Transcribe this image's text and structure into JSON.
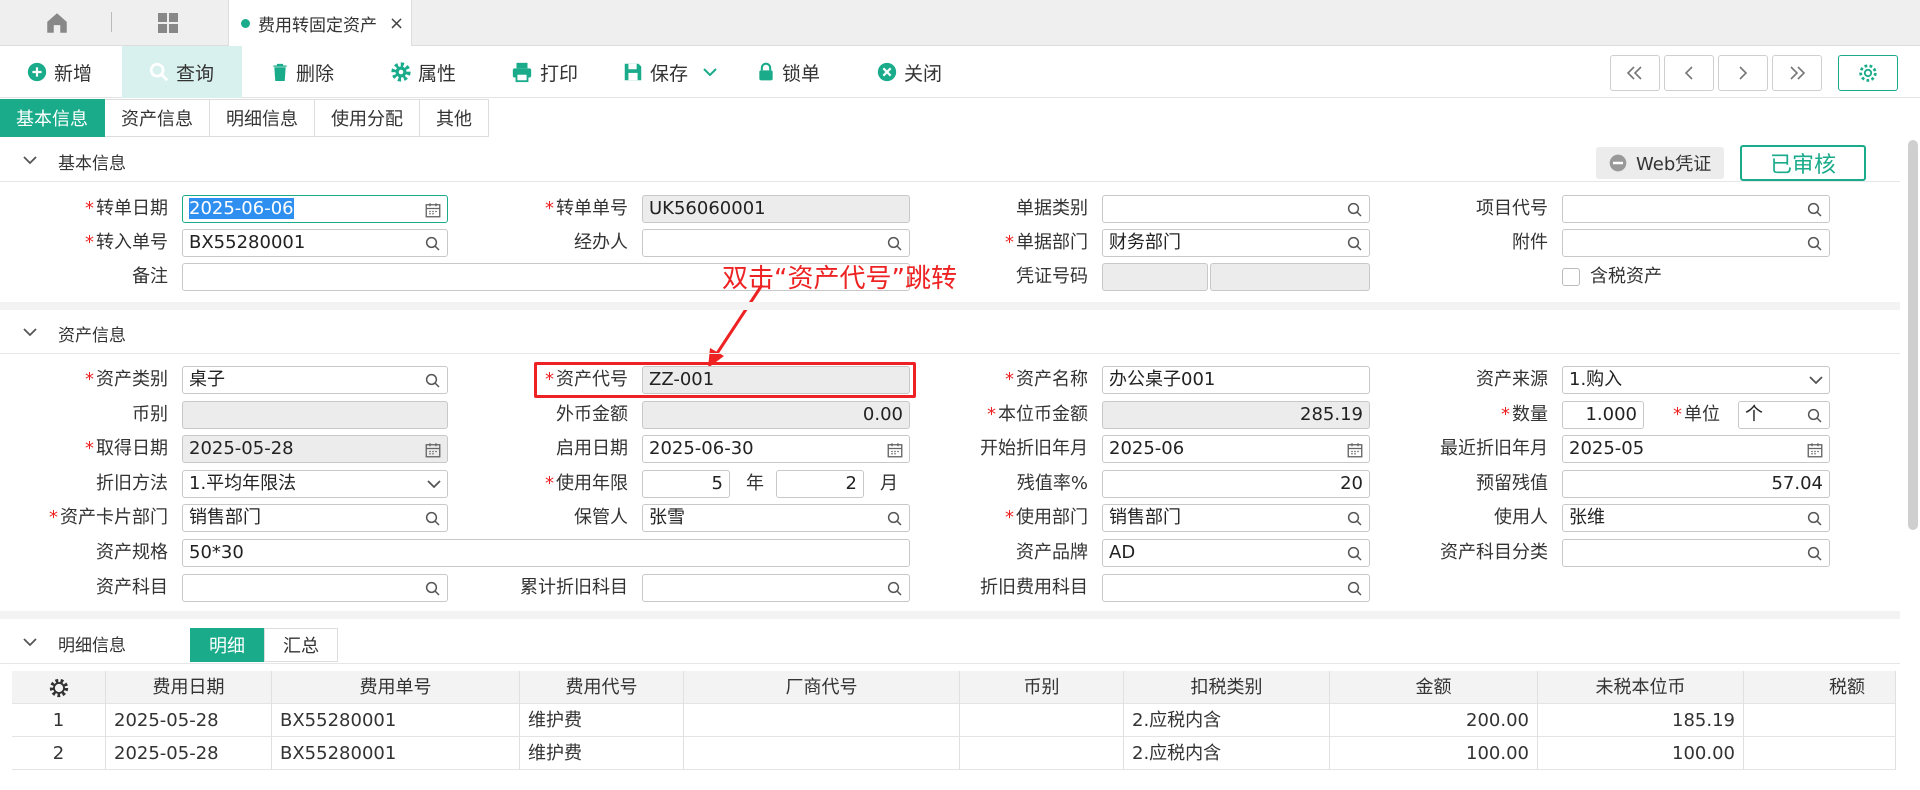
{
  "tabbar": {
    "doc_tab_label": "费用转固定资产",
    "close": "×"
  },
  "toolbar": {
    "new": "新增",
    "query": "查询",
    "delete": "删除",
    "props": "属性",
    "print": "打印",
    "save": "保存",
    "lock": "锁单",
    "close": "关闭"
  },
  "section_tabs": [
    "基本信息",
    "资产信息",
    "明细信息",
    "使用分配",
    "其他"
  ],
  "basic": {
    "title": "基本信息",
    "web_voucher": "Web凭证",
    "approved": "已审核",
    "transfer_date_label": "转单日期",
    "transfer_date": "2025-06-06",
    "transfer_no_label": "转单单号",
    "transfer_no": "UK56060001",
    "doc_type_label": "单据类别",
    "doc_type": "",
    "project_code_label": "项目代号",
    "project_code": "",
    "in_no_label": "转入单号",
    "in_no": "BX55280001",
    "handler_label": "经办人",
    "handler": "",
    "dept_label": "单据部门",
    "dept": "财务部门",
    "attach_label": "附件",
    "attach": "",
    "remark_label": "备注",
    "remark": "",
    "voucher_no_label": "凭证号码",
    "tax_asset_label": "含税资产"
  },
  "annotation": "双击“资产代号”跳转",
  "asset": {
    "title": "资产信息",
    "category_label": "资产类别",
    "category": "桌子",
    "code_label": "资产代号",
    "code": "ZZ-001",
    "name_label": "资产名称",
    "name": "办公桌子001",
    "source_label": "资产来源",
    "source": "1.购入",
    "currency_label": "币别",
    "currency": "",
    "foreign_amt_label": "外币金额",
    "foreign_amt": "0.00",
    "local_amt_label": "本位币金额",
    "local_amt": "285.19",
    "qty_label": "数量",
    "qty": "1.000",
    "unit_label": "单位",
    "unit": "个",
    "acquire_date_label": "取得日期",
    "acquire_date": "2025-05-28",
    "start_date_label": "启用日期",
    "start_date": "2025-06-30",
    "dep_start_label": "开始折旧年月",
    "dep_start": "2025-06",
    "dep_last_label": "最近折旧年月",
    "dep_last": "2025-05",
    "dep_method_label": "折旧方法",
    "dep_method": "1.平均年限法",
    "life_label": "使用年限",
    "life_years": "5",
    "year_unit": "年",
    "life_months": "2",
    "month_unit": "月",
    "residual_rate_label": "残值率%",
    "residual_rate": "20",
    "residual_label": "预留残值",
    "residual": "57.04",
    "card_dept_label": "资产卡片部门",
    "card_dept": "销售部门",
    "keeper_label": "保管人",
    "keeper": "张雪",
    "use_dept_label": "使用部门",
    "use_dept": "销售部门",
    "user_label": "使用人",
    "user": "张维",
    "spec_label": "资产规格",
    "spec": "50*30",
    "brand_label": "资产品牌",
    "brand": "AD",
    "subject_class_label": "资产科目分类",
    "subject_class": "",
    "subject_label": "资产科目",
    "subject": "",
    "acc_dep_label": "累计折旧科目",
    "acc_dep": "",
    "dep_fee_label": "折旧费用科目",
    "dep_fee": ""
  },
  "detail": {
    "title": "明细信息",
    "tabs": [
      "明细",
      "汇总"
    ],
    "columns": [
      "费用日期",
      "费用单号",
      "费用代号",
      "厂商代号",
      "币别",
      "扣税类别",
      "金额",
      "未税本位币",
      "税额"
    ],
    "rows": [
      [
        "1",
        "2025-05-28",
        "BX55280001",
        "维护费",
        "",
        "",
        "2.应税内含",
        "200.00",
        "185.19",
        ""
      ],
      [
        "2",
        "2025-05-28",
        "BX55280001",
        "维护费",
        "",
        "",
        "2.应税内含",
        "100.00",
        "100.00",
        ""
      ]
    ]
  }
}
